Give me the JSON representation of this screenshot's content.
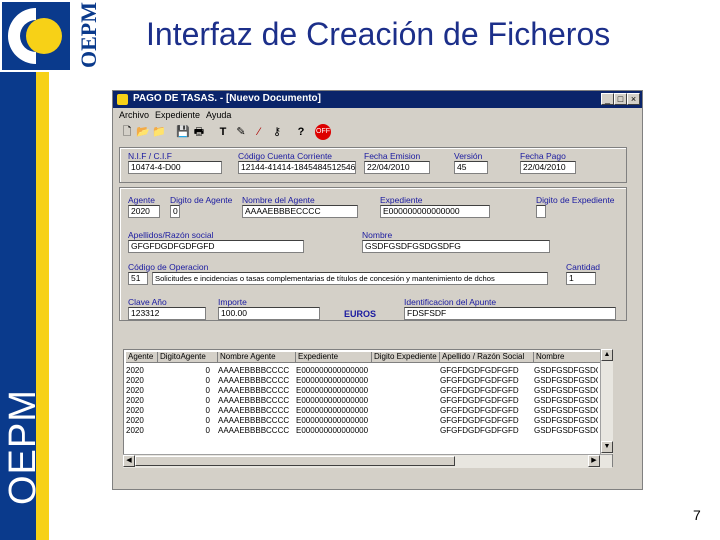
{
  "slide": {
    "title": "Interfaz de Creación de Ficheros",
    "side_text": "OEPM",
    "logo_text": "OEPM",
    "page_number": "7"
  },
  "window": {
    "title": "PAGO DE TASAS. - [Nuevo Documento]",
    "menu": [
      "Archivo",
      "Expediente",
      "Ayuda"
    ],
    "header": {
      "nif_label": "N.I.F / C.I.F",
      "nif_value": "10474-4-D00",
      "ccc_label": "Código Cuenta Corriente",
      "ccc_value": "12144-41414-1845484512546",
      "fecha_emision_label": "Fecha Emision",
      "fecha_emision_value": "22/04/2010",
      "version_label": "Versión",
      "version_value": "45",
      "fecha_pago_label": "Fecha Pago",
      "fecha_pago_value": "22/04/2010"
    },
    "form": {
      "agente_label": "Agente",
      "agente_value": "2020",
      "digito_agente_label": "Digito de Agente",
      "digito_agente_value": "0",
      "nombre_agente_label": "Nombre del Agente",
      "nombre_agente_value": "AAAAEBBBECCCC",
      "expediente_label": "Expediente",
      "expediente_value": "E000000000000000",
      "digito_expediente_label": "Digito de Expediente",
      "digito_expediente_value": "",
      "apellidos_label": "Apellidos/Razón social",
      "apellidos_value": "GFGFDGDFGDFGFD",
      "nombre_label": "Nombre",
      "nombre_value": "GSDFGSDFGSDGSDFG",
      "codigo_label": "Código de Operacion",
      "codigo_value": "51",
      "codigo_desc": "Solicitudes e incidencias o tasas complementarias de títulos de concesión y mantenimiento de dchos",
      "cantidad_label": "Cantidad",
      "cantidad_value": "1",
      "clave_label": "Clave Año",
      "clave_value": "123312",
      "importe_label": "Importe",
      "importe_value": "100.00",
      "euros_label": "EUROS",
      "identificacion_label": "Identificacion del Apunte",
      "identificacion_value": "FDSFSDF"
    },
    "grid": {
      "columns": [
        "Agente",
        "DigitoAgente",
        "Nombre Agente",
        "Expediente",
        "Digito Expediente",
        "Apellido / Razón Social",
        "Nombre"
      ],
      "rows": [
        [
          "2020",
          "0",
          "AAAAEBBBBCCCC",
          "E000000000000000",
          "",
          "GFGFDGDFGDFGFD",
          "GSDFGSDFGSDG"
        ],
        [
          "2020",
          "0",
          "AAAAEBBBBCCCC",
          "E000000000000000",
          "",
          "GFGFDGDFGDFGFD",
          "GSDFGSDFGSDG"
        ],
        [
          "2020",
          "0",
          "AAAAEBBBBCCCC",
          "E000000000000000",
          "",
          "GFGFDGDFGDFGFD",
          "GSDFGSDFGSDG"
        ],
        [
          "2020",
          "0",
          "AAAAEBBBBCCCC",
          "E000000000000000",
          "",
          "GFGFDGDFGDFGFD",
          "GSDFGSDFGSDG"
        ],
        [
          "2020",
          "0",
          "AAAAEBBBBCCCC",
          "E000000000000000",
          "",
          "GFGFDGDFGDFGFD",
          "GSDFGSDFGSDG"
        ],
        [
          "2020",
          "0",
          "AAAAEBBBBCCCC",
          "E000000000000000",
          "",
          "GFGFDGDFGDFGFD",
          "GSDFGSDFGSDG"
        ],
        [
          "2020",
          "0",
          "AAAAEBBBBCCCC",
          "E000000000000000",
          "",
          "GFGFDGDFGDFGFD",
          "GSDFGSDFGSDG"
        ]
      ]
    },
    "toolbar_icons": [
      "new-icon",
      "open-icon",
      "folder-icon",
      "save-icon",
      "print-icon",
      "text-icon",
      "magic-icon",
      "brush-icon",
      "key-icon",
      "help-icon",
      "exit-icon"
    ]
  },
  "colors": {
    "brand_blue": "#0a3a8c",
    "brand_yellow": "#f7d117",
    "title_blue": "#1c2f8a",
    "titlebar": "#0a246a"
  }
}
